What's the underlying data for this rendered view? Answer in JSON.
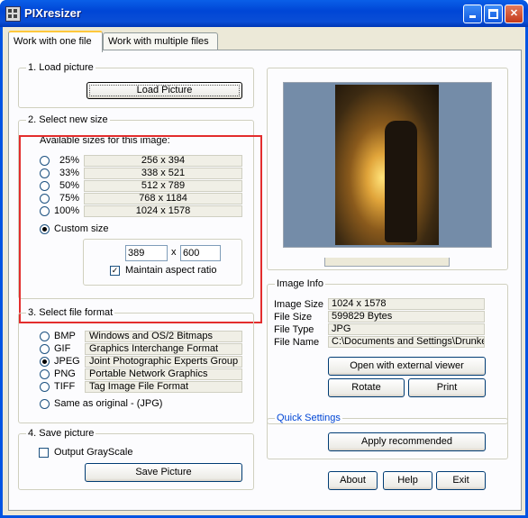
{
  "window": {
    "title": "PIXresizer"
  },
  "tabs": [
    {
      "label": "Work with one file"
    },
    {
      "label": "Work with multiple files"
    }
  ],
  "load": {
    "title": "1. Load picture",
    "button": "Load Picture"
  },
  "size": {
    "title": "2. Select new size",
    "available_label": "Available sizes for this image:",
    "options": [
      {
        "pct": "25%",
        "dims": "256 x 394",
        "selected": false
      },
      {
        "pct": "33%",
        "dims": "338 x 521",
        "selected": false
      },
      {
        "pct": "50%",
        "dims": "512 x 789",
        "selected": false
      },
      {
        "pct": "75%",
        "dims": "768 x 1184",
        "selected": false
      },
      {
        "pct": "100%",
        "dims": "1024 x 1578",
        "selected": false
      }
    ],
    "custom_label": "Custom size",
    "custom_selected": true,
    "width": "389",
    "x_sep": "x",
    "height": "600",
    "aspect_label": "Maintain aspect ratio",
    "aspect_checked": true
  },
  "format": {
    "title": "3. Select file format",
    "options": [
      {
        "name": "BMP",
        "desc": "Windows and OS/2 Bitmaps",
        "selected": false
      },
      {
        "name": "GIF",
        "desc": "Graphics Interchange Format",
        "selected": false
      },
      {
        "name": "JPEG",
        "desc": "Joint Photographic Experts Group",
        "selected": true
      },
      {
        "name": "PNG",
        "desc": "Portable Network Graphics",
        "selected": false
      },
      {
        "name": "TIFF",
        "desc": "Tag Image File Format",
        "selected": false
      }
    ],
    "same_label": "Same as original  - (JPG)"
  },
  "save": {
    "title": "4. Save picture",
    "grayscale_label": "Output GrayScale",
    "grayscale_checked": false,
    "button": "Save Picture"
  },
  "info": {
    "title": "Image Info",
    "rows": [
      {
        "label": "Image Size",
        "value": "1024 x 1578"
      },
      {
        "label": "File Size",
        "value": "599829 Bytes"
      },
      {
        "label": "File Type",
        "value": "JPG"
      },
      {
        "label": "File Name",
        "value": "C:\\Documents and Settings\\Drunker"
      }
    ],
    "open_button": "Open with external viewer",
    "rotate_button": "Rotate",
    "print_button": "Print"
  },
  "quick": {
    "title": "Quick Settings",
    "apply_button": "Apply recommended"
  },
  "bottom": {
    "about": "About",
    "help": "Help",
    "exit": "Exit"
  }
}
